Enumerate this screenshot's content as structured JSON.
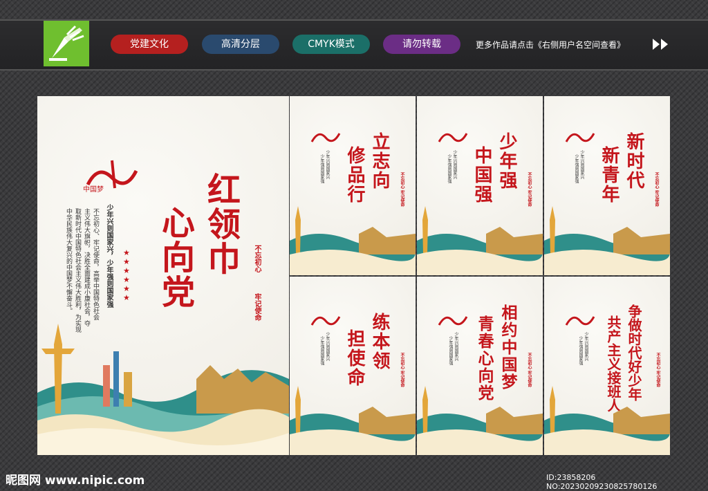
{
  "header": {
    "tags": [
      {
        "label": "党建文化",
        "color": "#b5201f"
      },
      {
        "label": "高清分层",
        "color": "#2a4a6e"
      },
      {
        "label": "CMYK模式",
        "color": "#1b6f68"
      },
      {
        "label": "请勿转载",
        "color": "#6b2d85"
      }
    ],
    "more_text": "更多作品请点击《右侧用户名空间查看》"
  },
  "main_poster": {
    "brand": "中国梦",
    "title_col1": "红领巾",
    "title_col2": "心向党",
    "stamp_left": "不忘初心",
    "stamp_right": "牢记使命",
    "slogan": "少年兴则国家兴，少年强则国家强",
    "body_col1": "不忘初心、牢记使命，高举中国特色社会",
    "body_col2": "主义伟大旗帜，决胜全面建成小康社会，夺",
    "body_col3": "取新时代中国特色社会主义伟大胜利，为实现",
    "body_col4": "中华民族伟大复兴的中国梦不懈奋斗。"
  },
  "small_posters": [
    {
      "title_col1": "立志向",
      "title_col2": "修品行"
    },
    {
      "title_col1": "少年强",
      "title_col2": "中国强"
    },
    {
      "title_col1": "新时代",
      "title_col2": "新青年"
    },
    {
      "title_col1": "练本领",
      "title_col2": "担使命"
    },
    {
      "title_col1": "相约中国梦",
      "title_col2": "青春心向党"
    },
    {
      "title_col1": "争做时代好少年",
      "title_col2": "共产主义接班人"
    }
  ],
  "small_common": {
    "slogan1": "少年兴则国家兴",
    "slogan2": "少年强则国家强",
    "stamp": "不忘初心 牢记使命"
  },
  "watermark": {
    "site": "昵图网 www.nipic.com",
    "id": "ID:23858206 NO:20230209230825780126"
  }
}
